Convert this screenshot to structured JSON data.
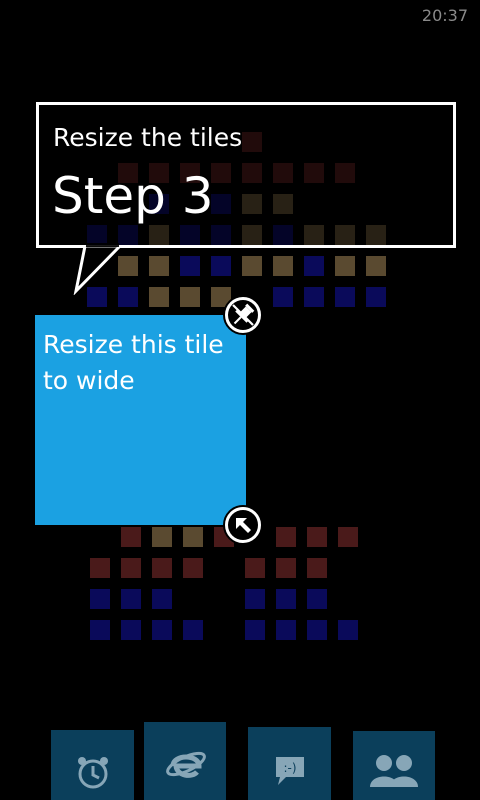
{
  "status": {
    "time": "20:37"
  },
  "tutorial": {
    "subtitle": "Resize the tiles",
    "title": "Step 3"
  },
  "tile": {
    "label": "Resize this tile to wide",
    "color": "#1ba1e2"
  },
  "controls": {
    "unpin_icon": "unpin-icon",
    "resize_icon": "resize-arrow-icon"
  },
  "dock": {
    "items": [
      {
        "name": "alarms",
        "icon": "alarm-clock-icon"
      },
      {
        "name": "internet-explorer",
        "icon": "ie-icon"
      },
      {
        "name": "messaging",
        "icon": "messaging-icon"
      },
      {
        "name": "people",
        "icon": "people-icon"
      }
    ]
  }
}
